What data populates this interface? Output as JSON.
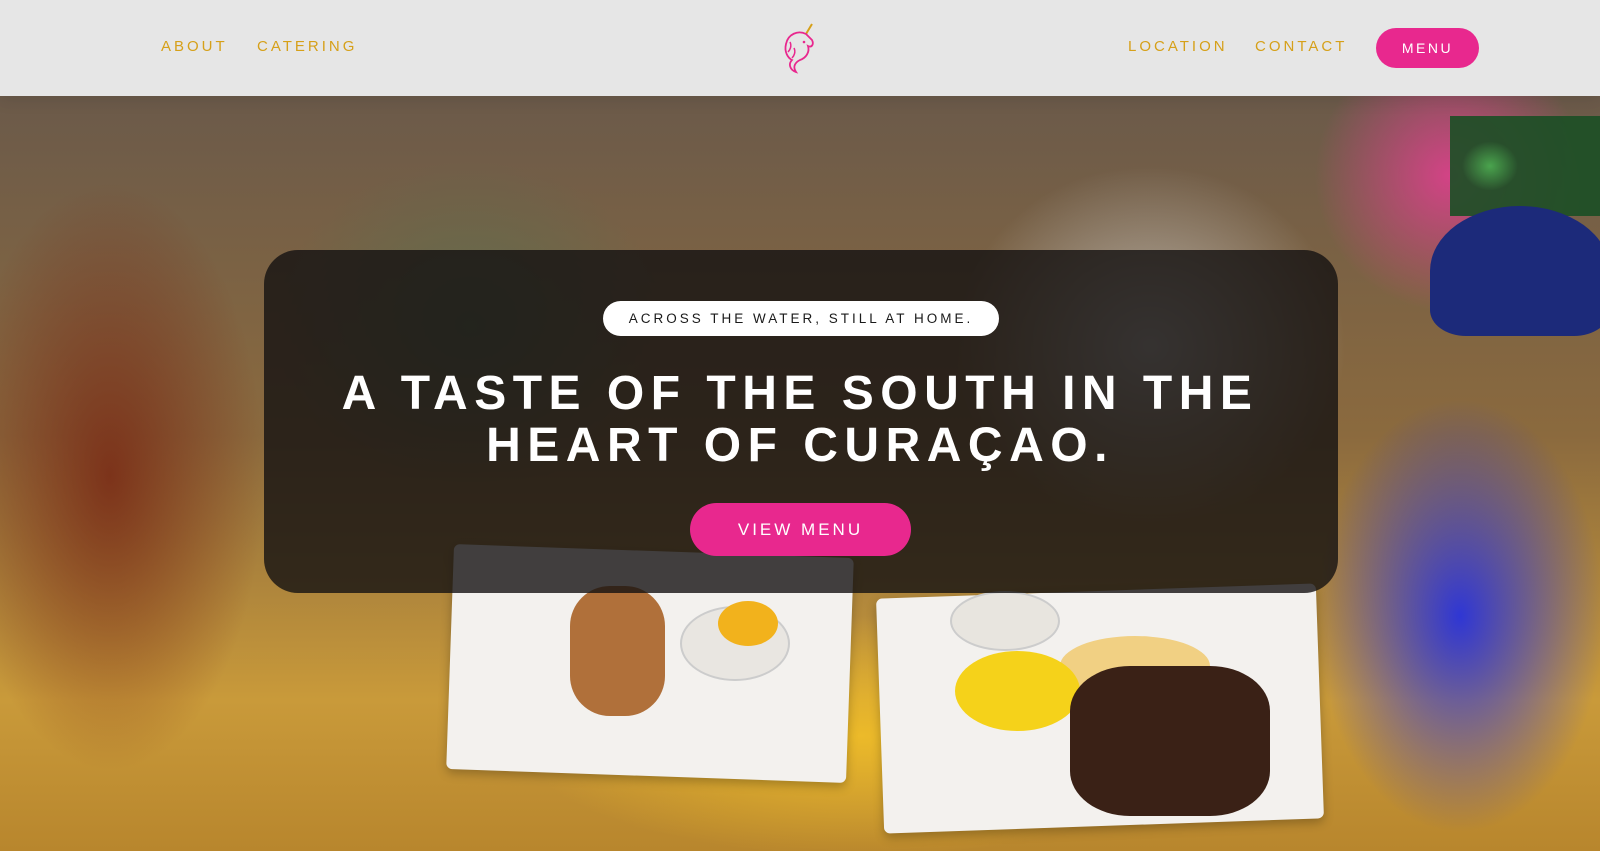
{
  "nav": {
    "left": [
      {
        "label": "ABOUT"
      },
      {
        "label": "CATERING"
      }
    ],
    "right": [
      {
        "label": "LOCATION"
      },
      {
        "label": "CONTACT"
      }
    ],
    "menu_button": "MENU",
    "logo_icon": "unicorn-head-icon"
  },
  "hero": {
    "tagline": "ACROSS THE WATER, STILL AT HOME.",
    "headline_line1": "A TASTE OF THE SOUTH IN THE",
    "headline_line2": "HEART OF CURAÇAO.",
    "cta_label": "VIEW MENU",
    "background_image": "people-dining-at-table-photo"
  },
  "colors": {
    "accent_pink": "#e8288e",
    "nav_gold": "#d6a019",
    "header_bg": "#e6e6e6",
    "card_overlay": "rgba(20,18,18,0.80)"
  }
}
